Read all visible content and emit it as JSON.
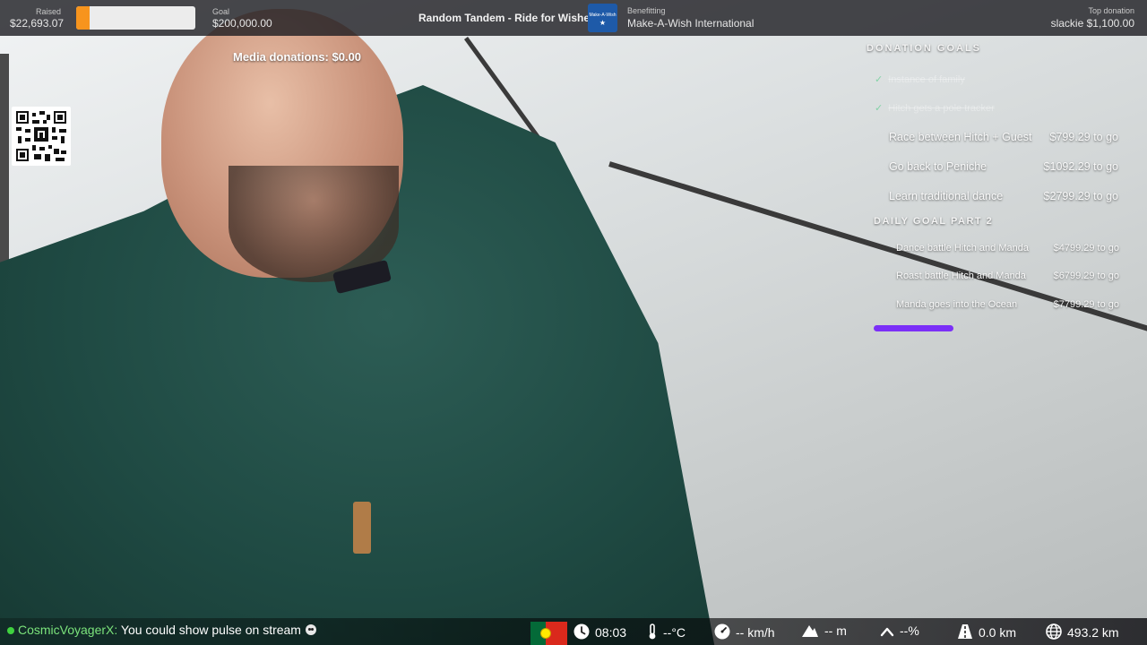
{
  "topbar": {
    "raised_label": "Raised",
    "raised_value": "$22,693.07",
    "progress_fraction": 0.113,
    "progress_color": "#f7941d",
    "goal_label": "Goal",
    "goal_value": "$200,000.00",
    "event_title": "Random Tandem - Ride for Wishes",
    "charity_logo_text": "Make-A-Wish",
    "benefitting_label": "Benefitting",
    "benefitting_value": "Make-A-Wish International",
    "top_donation_label": "Top donation",
    "top_donation_value": "slackie $1,100.00"
  },
  "media_donations": "Media donations: $0.00",
  "donation_goals": {
    "heading": "DONATION GOALS",
    "completed": [
      "Instance of family",
      "Hitch gets a pole tracker"
    ],
    "items": [
      {
        "label": "Race between Hitch + Guest",
        "amount": "$799.29 to go"
      },
      {
        "label": "Go back to Peniche",
        "amount": "$1092.29 to go"
      },
      {
        "label": "Learn traditional dance",
        "amount": "$2799.29 to go"
      }
    ],
    "part2_heading": "DAILY GOAL PART 2",
    "part2_items": [
      {
        "label": "Dance battle Hitch and Manda",
        "amount": "$4799.29 to go"
      },
      {
        "label": "Roast battle Hitch and Manda",
        "amount": "$6799.29 to go"
      },
      {
        "label": "Manda goes into the Ocean",
        "amount": "$7799.29 to go"
      }
    ],
    "bar_color": "#7b2ff7"
  },
  "chat": {
    "username": "CosmicVoyagerX:",
    "message": "You could show pulse on stream",
    "username_color": "#7be37b"
  },
  "stats": {
    "time": "08:03",
    "temperature": "--°C",
    "speed": "-- km/h",
    "altitude": "-- m",
    "incline": "--%",
    "distance": "0.0 km",
    "total_distance": "493.2 km"
  },
  "icons": [
    "qr-code",
    "portugal-flag",
    "clock-icon",
    "thermometer-icon",
    "speedometer-icon",
    "mountain-icon",
    "incline-icon",
    "road-icon",
    "globe-icon"
  ]
}
